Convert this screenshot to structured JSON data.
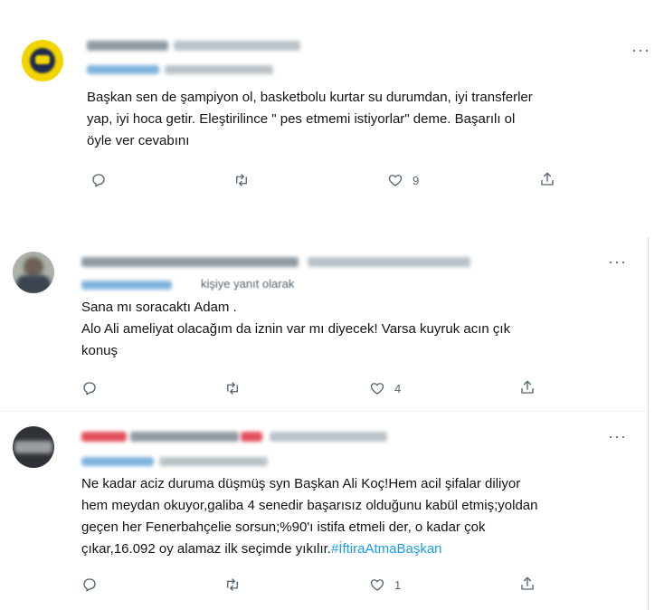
{
  "tweets": [
    {
      "more": "···",
      "text": "Başkan sen de şampiyon ol, basketbolu kurtar su durumdan, iyi transferler yap, iyi hoca getir. Eleştirilince \" pes etmemi istiyorlar\" deme. Başarılı ol öyle ver cevabını",
      "text_lines": [
        "Başkan sen de şampiyon ol, basketbolu kurtar su durumdan, iyi transferler",
        "yap, iyi hoca getir. Eleştirilince \" pes etmemi istiyorlar\" deme. Başarılı ol",
        "öyle ver cevabını"
      ],
      "likes": "9",
      "replies_count": "",
      "retweets_count": ""
    },
    {
      "more": "···",
      "reply_label": "kişiye yanıt olarak",
      "text_lines": [
        "Sana mı soracaktı Adam .",
        "Alo Ali ameliyat olacağım da iznin var mı diyecek! Varsa kuyruk acın çık",
        "konuş"
      ],
      "likes": "4",
      "replies_count": "",
      "retweets_count": ""
    },
    {
      "more": "···",
      "text_lines": [
        "Ne kadar aciz duruma düşmüş syn Başkan Ali Koç!Hem acil şifalar diliyor",
        "hem meydan okuyor,galiba 4 senedir başarısız olduğunu kabül etmiş;yoldan",
        "geçen her Fenerbahçelie sorsun;%90'ı istifa etmeli der, o kadar çok",
        "çıkar,16.092 oy alamaz ilk seçimde yıkılır."
      ],
      "hashtag": "#İftiraAtmaBaşkan",
      "likes": "1",
      "replies_count": "",
      "retweets_count": ""
    }
  ],
  "colors": {
    "text": "#0f1419",
    "muted": "#536471",
    "link": "#1d9bf0"
  },
  "icons": [
    "reply-icon",
    "retweet-icon",
    "like-icon",
    "share-icon",
    "more-icon"
  ]
}
